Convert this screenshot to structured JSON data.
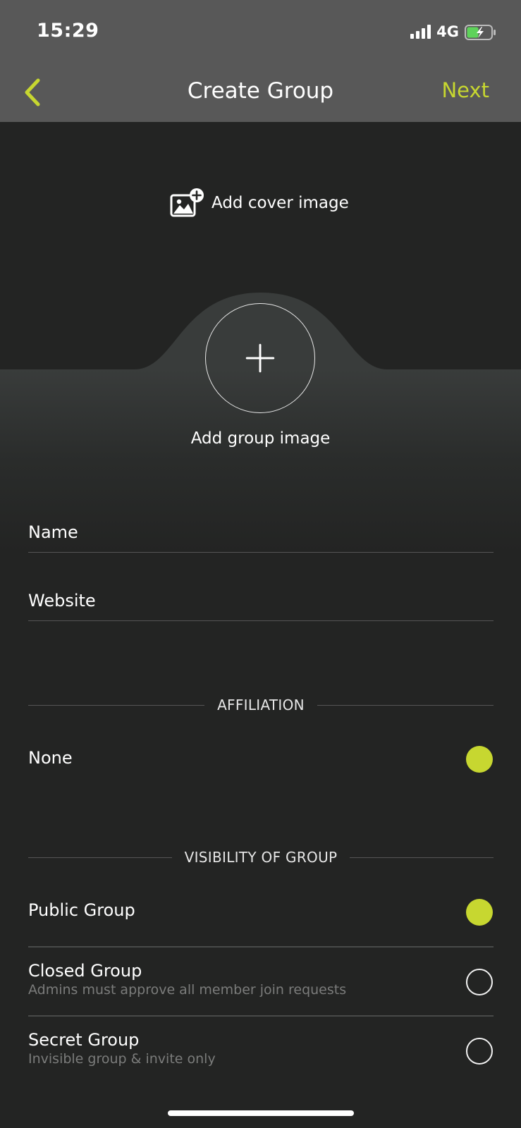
{
  "status_bar": {
    "time": "15:29",
    "network": "4G"
  },
  "nav": {
    "title": "Create Group",
    "next_label": "Next"
  },
  "cover": {
    "label": "Add cover image"
  },
  "avatar": {
    "label": "Add group image"
  },
  "form": {
    "name": {
      "placeholder": "Name",
      "value": ""
    },
    "website": {
      "placeholder": "Website",
      "value": ""
    }
  },
  "affiliation": {
    "header": "AFFILIATION",
    "options": [
      {
        "label": "None",
        "selected": true
      }
    ]
  },
  "visibility": {
    "header": "VISIBILITY OF GROUP",
    "options": [
      {
        "label": "Public Group",
        "description": "",
        "selected": true
      },
      {
        "label": "Closed Group",
        "description": "Admins must approve all member join requests",
        "selected": false
      },
      {
        "label": "Secret Group",
        "description": "Invisible group & invite only",
        "selected": false
      }
    ]
  },
  "colors": {
    "accent": "#c7d730",
    "header_bg": "#585858",
    "page_bg": "#232423"
  }
}
